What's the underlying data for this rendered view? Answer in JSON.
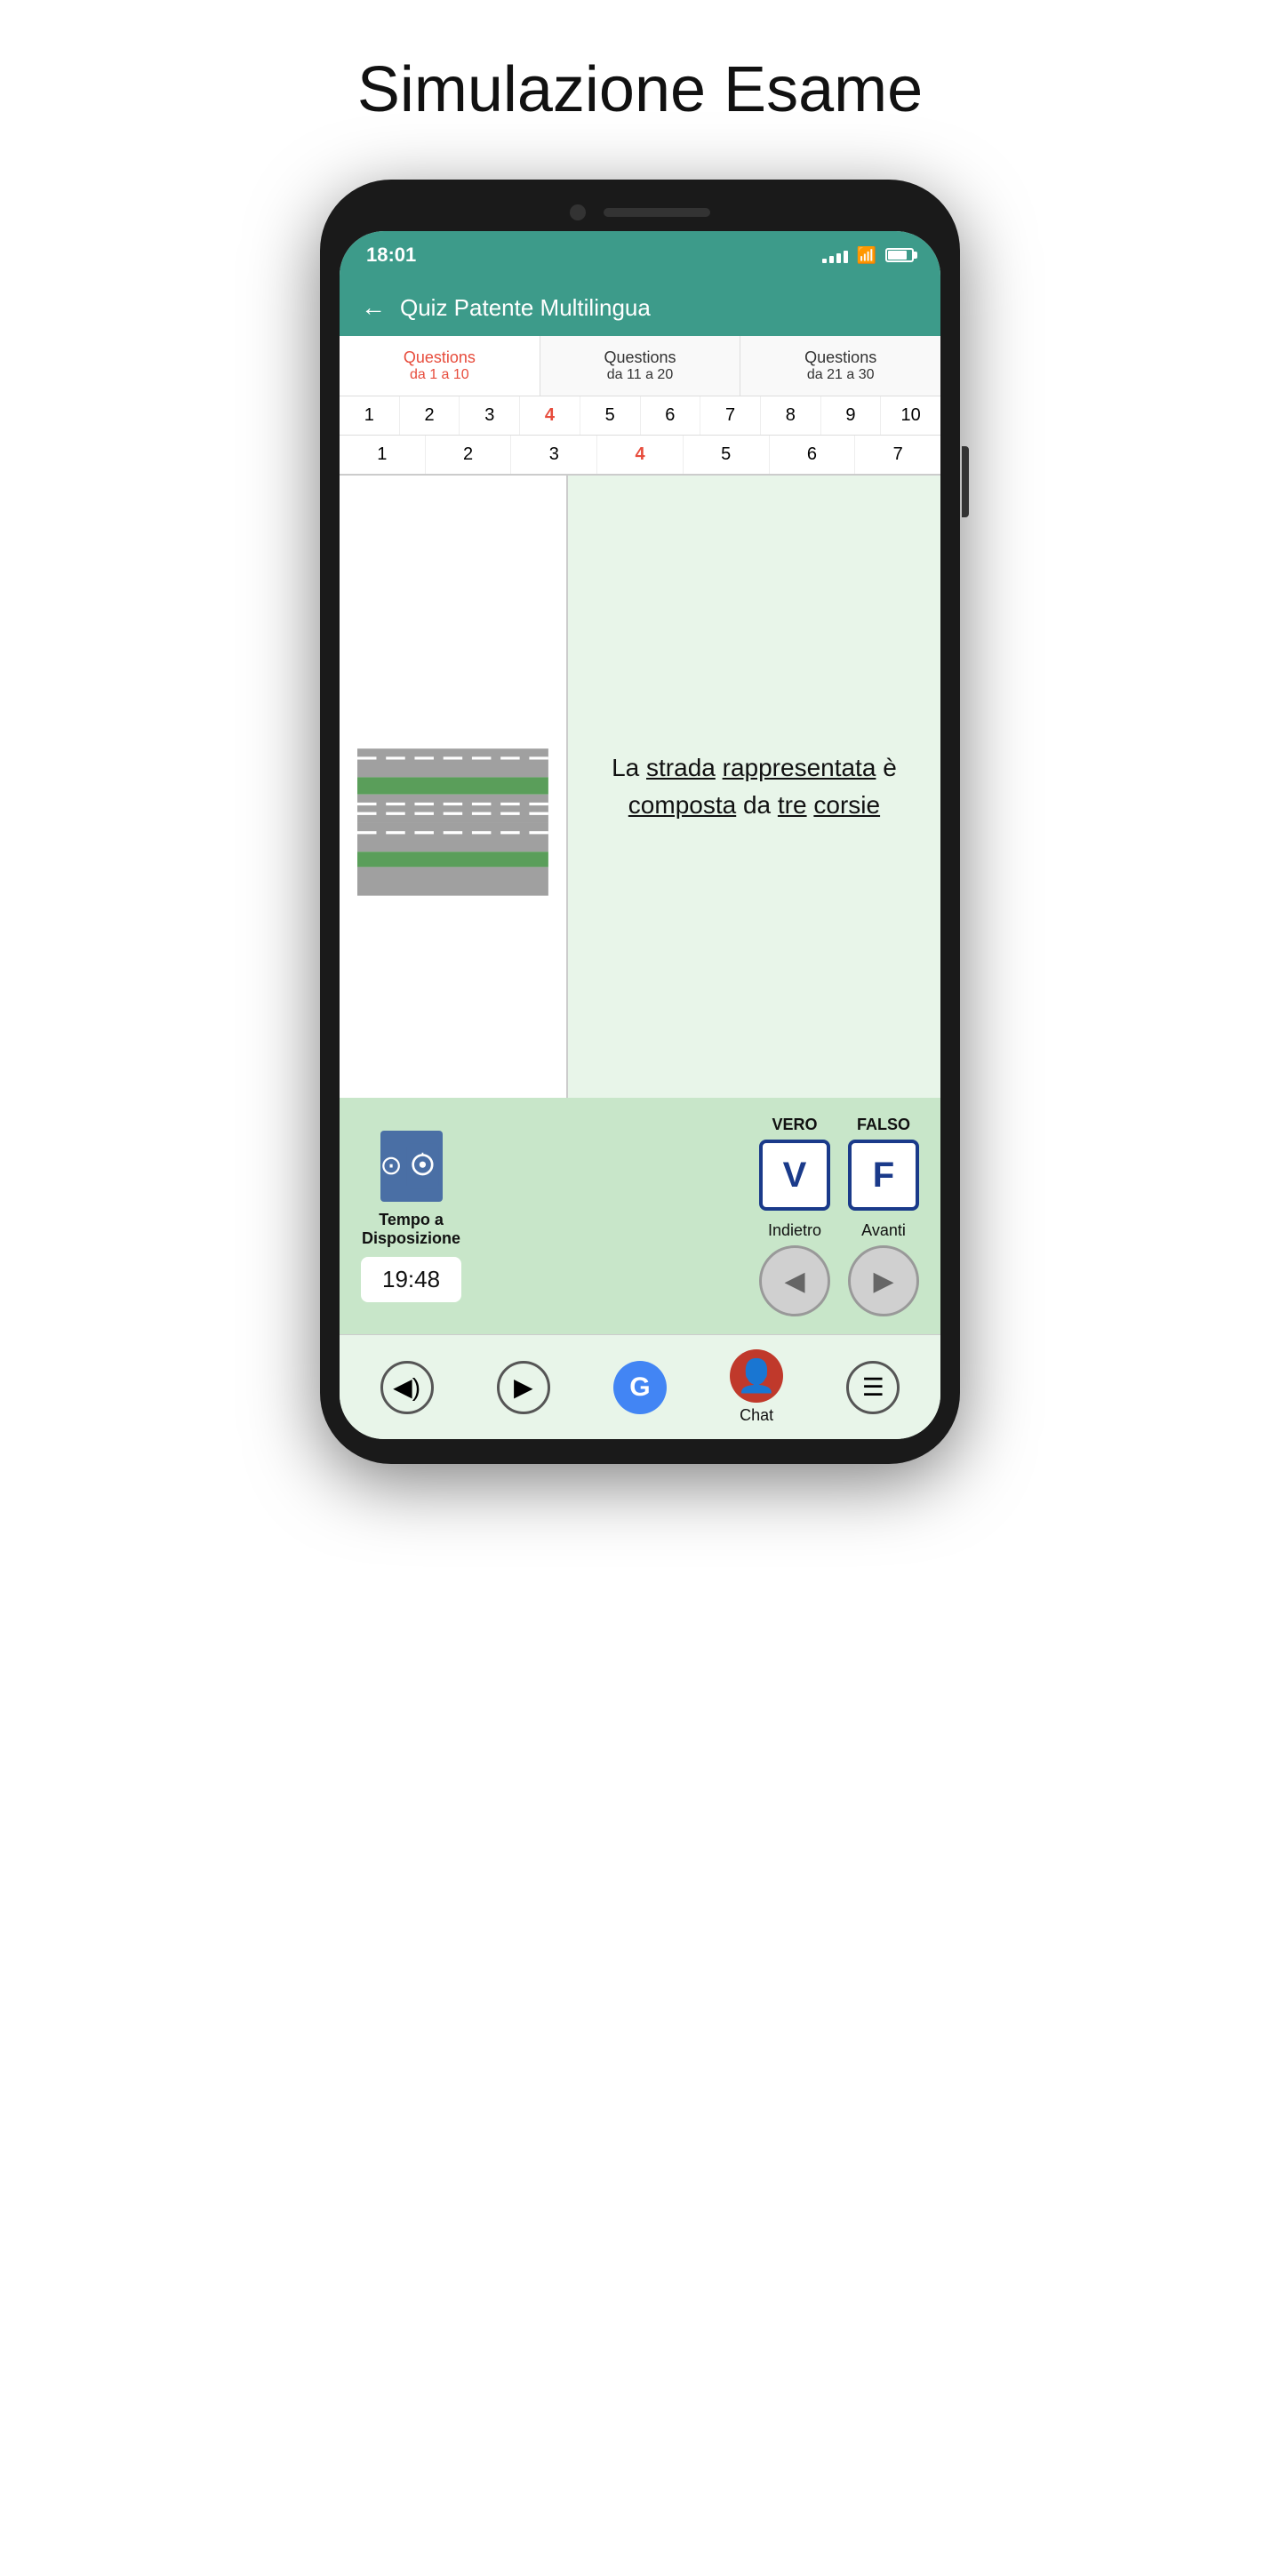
{
  "pageTitle": "Simulazione Esame",
  "statusBar": {
    "time": "18:01",
    "signalBars": [
      4,
      6,
      10,
      14,
      18
    ],
    "wifi": "wifi",
    "battery": 80
  },
  "appHeader": {
    "backLabel": "←",
    "title": "Quiz Patente Multilingua"
  },
  "questionsTabs": [
    {
      "title": "Questions",
      "range": "da 1 a 10",
      "active": true
    },
    {
      "title": "Questions",
      "range": "da 11 a 20",
      "active": false
    },
    {
      "title": "Questions",
      "range": "da 21 a 30",
      "active": false
    }
  ],
  "numberRow": [
    "1",
    "2",
    "3",
    "4",
    "5",
    "6",
    "7",
    "8",
    "9",
    "10"
  ],
  "activeNumber": "4",
  "subNumberRow": [
    "1",
    "2",
    "3",
    "4",
    "5",
    "6",
    "7"
  ],
  "activeSubNumber": "4",
  "questionText": "La strada rappresentata è composta da tre corsie",
  "timerLabel": "Tempo a\nDisposizione",
  "timer": "19:48",
  "veroLabel": "VERO",
  "falsoLabel": "FALSO",
  "veroSymbol": "V",
  "falsoSymbol": "F",
  "indietroLabel": "Indietro",
  "avantiLabel": "Avanti",
  "toolbar": {
    "items": [
      {
        "label": "",
        "icon": "sound",
        "symbol": "◀)"
      },
      {
        "label": "",
        "icon": "play",
        "symbol": "▶"
      },
      {
        "label": "",
        "icon": "translate",
        "symbol": "G"
      },
      {
        "label": "Chat",
        "icon": "chat-avatar",
        "symbol": "👤"
      },
      {
        "label": "",
        "icon": "menu",
        "symbol": "☰"
      }
    ]
  }
}
